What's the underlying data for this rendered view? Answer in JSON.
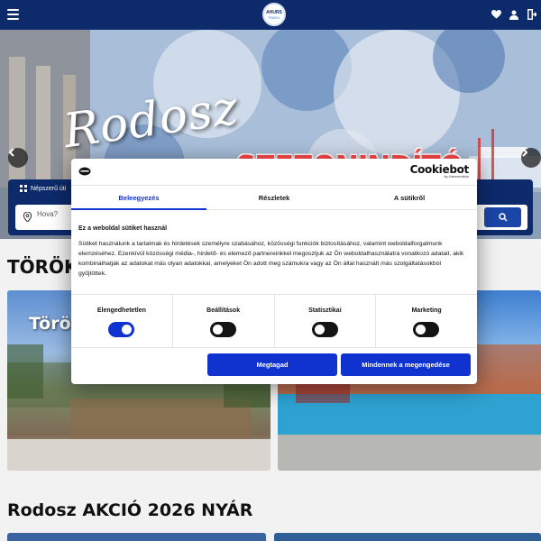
{
  "header": {
    "logo": {
      "line1": "AHURS",
      "line2": "TRAVEL"
    },
    "icons": [
      "menu-icon",
      "heart-icon",
      "user-icon",
      "logout-icon"
    ]
  },
  "hero": {
    "script_text": "Rodosz",
    "banner_text": "SZEZONINDÍTÓ AKCIÓ"
  },
  "search": {
    "popular_label": "Népszerű úti",
    "placeholder": "Hova?"
  },
  "sections": [
    {
      "title": "TÖRÖK",
      "cards": [
        {
          "label": "Török"
        },
        {
          "label": ""
        }
      ]
    },
    {
      "title": "Rodosz AKCIÓ 2026 NYÁR"
    }
  ],
  "cookie_dialog": {
    "brand": "Cookiebot",
    "brand_sub": "by Usercentrics",
    "tabs": [
      {
        "label": "Beleegyezés",
        "active": true
      },
      {
        "label": "Részletek",
        "active": false
      },
      {
        "label": "A sütikről",
        "active": false
      }
    ],
    "heading": "Ez a weboldal sütiket használ",
    "body": "Sütiket használunk a tartalmak és hirdetések személyre szabásához, közösségi funkciók biztosításához, valamint weboldalforgalmunk elemzéséhez. Ezenkívül közösségi média-, hirdető- és elemező partnereinkkel megosztjuk az Ön weboldalhasználatra vonatkozó adatait, akik kombinálhatják az adatokat más olyan adatokkal, amelyeket Ön adott meg számukra vagy az Ön által használt más szolgáltatásokból gyűjtöttek.",
    "categories": [
      {
        "label": "Elengedhetetlen",
        "enabled": true
      },
      {
        "label": "Beállítások",
        "enabled": false
      },
      {
        "label": "Statisztikai",
        "enabled": false
      },
      {
        "label": "Marketing",
        "enabled": false
      }
    ],
    "deny_label": "Megtagad",
    "allow_all_label": "Mindennek a megengedése",
    "accent_color": "#1032cf"
  }
}
